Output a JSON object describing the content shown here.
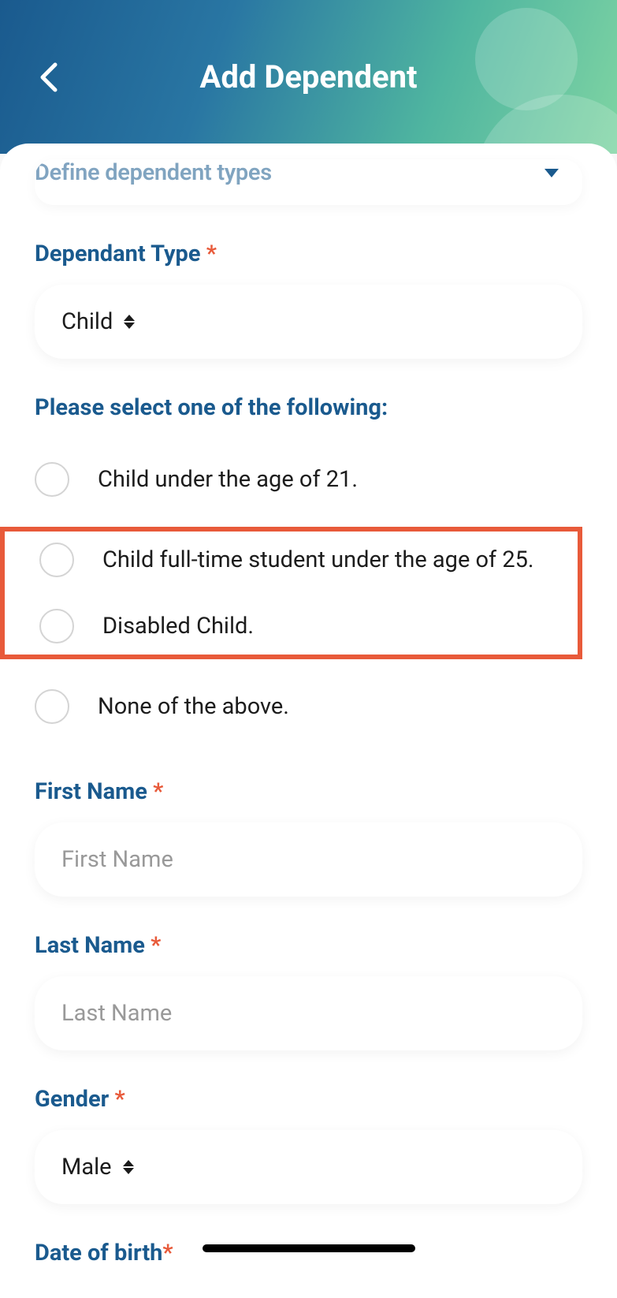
{
  "header": {
    "title": "Add Dependent"
  },
  "define_types": {
    "label": "Define dependent types"
  },
  "dependant_type": {
    "label": "Dependant Type",
    "value": "Child"
  },
  "subtype": {
    "label": "Please select one of the following:",
    "options": {
      "under21": "Child under the age of 21.",
      "student25": "Child full-time student under the age of 25.",
      "disabled": "Disabled Child.",
      "none": "None of the above."
    }
  },
  "first_name": {
    "label": "First Name",
    "placeholder": "First Name"
  },
  "last_name": {
    "label": "Last Name",
    "placeholder": "Last Name"
  },
  "gender": {
    "label": "Gender",
    "value": "Male"
  },
  "dob": {
    "label": "Date of birth"
  }
}
